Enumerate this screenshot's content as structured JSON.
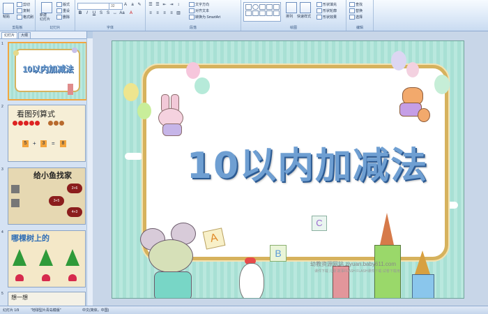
{
  "ribbon": {
    "clipboard": {
      "group_label": "剪贴板",
      "paste": "粘贴",
      "cut": "剪切",
      "copy": "复制",
      "format_painter": "格式刷"
    },
    "slides": {
      "group_label": "幻灯片",
      "new_slide_line1": "新建",
      "new_slide_line2": "幻灯片",
      "layout": "版式",
      "reset": "重设",
      "delete": "删除"
    },
    "font": {
      "group_label": "字体",
      "font_size": "32"
    },
    "paragraph": {
      "group_label": "段落",
      "text_direction": "文字方向",
      "align_text": "对齐文本",
      "convert_smartart": "转换为 SmartArt"
    },
    "drawing": {
      "group_label": "绘图",
      "arrange": "排列",
      "quick_styles": "快速样式",
      "shape_fill": "形状填充",
      "shape_outline": "形状轮廓",
      "shape_effects": "形状效果"
    },
    "editing": {
      "group_label": "编辑",
      "find": "查找",
      "replace": "替换",
      "select": "选择"
    }
  },
  "pane": {
    "tab_slides": "幻灯片",
    "tab_outline": "大纲",
    "thumbnails": [
      {
        "num": "1",
        "title": "10以内加减法"
      },
      {
        "num": "2",
        "title": "看图列算式",
        "eq_a": "5",
        "eq_op": "+",
        "eq_b": "3",
        "eq_eq": "=",
        "eq_c": "8"
      },
      {
        "num": "3",
        "title": "给小鱼找家",
        "cloud1": "2+6",
        "cloud2": "3+5",
        "cloud3": "4+3"
      },
      {
        "num": "4",
        "title": "哪棵树上的"
      },
      {
        "num": "5",
        "title": "想一想"
      }
    ]
  },
  "slide": {
    "title": "10以内加减法",
    "letter_a": "A",
    "letter_b": "B",
    "letter_c": "C",
    "watermark_line1": "幼教资源网站  ziyuan.baby611.com",
    "watermark_line2": "课件下载   儿歌   故事FLASH   FLASH课件下载   试卷下载用"
  },
  "status": {
    "slide_counter": "幻灯片 1/9",
    "theme": "\"地球型片青岛模版\"",
    "language": "中文(简体，中国)"
  }
}
